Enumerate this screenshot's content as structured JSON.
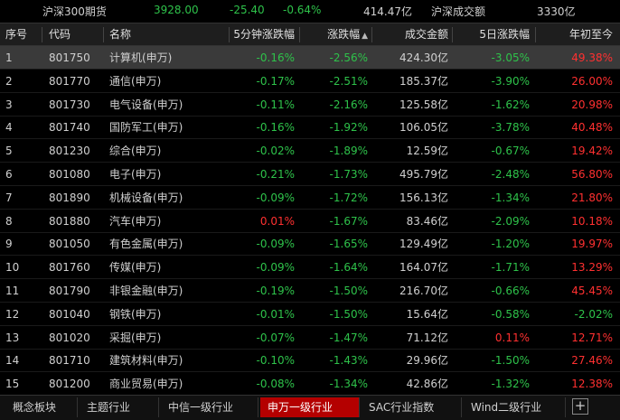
{
  "ticker": {
    "name": "沪深300期货",
    "price": "3928.00",
    "change": "-25.40",
    "change_pct": "-0.64%",
    "amount": "414.47亿",
    "turnover_label": "沪深成交额",
    "turnover_value": "3330亿"
  },
  "columns": {
    "seq": "序号",
    "code": "代码",
    "name": "名称",
    "five_min": "5分钟涨跌幅",
    "change": "涨跌幅",
    "amount": "成交金额",
    "five_day": "5日涨跌幅",
    "ytd": "年初至今",
    "sort_arrow": "▲"
  },
  "rows": [
    {
      "seq": "1",
      "code": "801750",
      "name": "计算机(申万)",
      "five_min": "-0.16%",
      "change": "-2.56%",
      "amount": "424.30亿",
      "five_day": "-3.05%",
      "ytd": "49.38%"
    },
    {
      "seq": "2",
      "code": "801770",
      "name": "通信(申万)",
      "five_min": "-0.17%",
      "change": "-2.51%",
      "amount": "185.37亿",
      "five_day": "-3.90%",
      "ytd": "26.00%"
    },
    {
      "seq": "3",
      "code": "801730",
      "name": "电气设备(申万)",
      "five_min": "-0.11%",
      "change": "-2.16%",
      "amount": "125.58亿",
      "five_day": "-1.62%",
      "ytd": "20.98%"
    },
    {
      "seq": "4",
      "code": "801740",
      "name": "国防军工(申万)",
      "five_min": "-0.16%",
      "change": "-1.92%",
      "amount": "106.05亿",
      "five_day": "-3.78%",
      "ytd": "40.48%"
    },
    {
      "seq": "5",
      "code": "801230",
      "name": "综合(申万)",
      "five_min": "-0.02%",
      "change": "-1.89%",
      "amount": "12.59亿",
      "five_day": "-0.67%",
      "ytd": "19.42%"
    },
    {
      "seq": "6",
      "code": "801080",
      "name": "电子(申万)",
      "five_min": "-0.21%",
      "change": "-1.73%",
      "amount": "495.79亿",
      "five_day": "-2.48%",
      "ytd": "56.80%"
    },
    {
      "seq": "7",
      "code": "801890",
      "name": "机械设备(申万)",
      "five_min": "-0.09%",
      "change": "-1.72%",
      "amount": "156.13亿",
      "five_day": "-1.34%",
      "ytd": "21.80%"
    },
    {
      "seq": "8",
      "code": "801880",
      "name": "汽车(申万)",
      "five_min": "0.01%",
      "change": "-1.67%",
      "amount": "83.46亿",
      "five_day": "-2.09%",
      "ytd": "10.18%"
    },
    {
      "seq": "9",
      "code": "801050",
      "name": "有色金属(申万)",
      "five_min": "-0.09%",
      "change": "-1.65%",
      "amount": "129.49亿",
      "five_day": "-1.20%",
      "ytd": "19.97%"
    },
    {
      "seq": "10",
      "code": "801760",
      "name": "传媒(申万)",
      "five_min": "-0.09%",
      "change": "-1.64%",
      "amount": "164.07亿",
      "five_day": "-1.71%",
      "ytd": "13.29%"
    },
    {
      "seq": "11",
      "code": "801790",
      "name": "非银金融(申万)",
      "five_min": "-0.19%",
      "change": "-1.50%",
      "amount": "216.70亿",
      "five_day": "-0.66%",
      "ytd": "45.45%"
    },
    {
      "seq": "12",
      "code": "801040",
      "name": "钢铁(申万)",
      "five_min": "-0.01%",
      "change": "-1.50%",
      "amount": "15.64亿",
      "five_day": "-0.58%",
      "ytd": "-2.02%"
    },
    {
      "seq": "13",
      "code": "801020",
      "name": "采掘(申万)",
      "five_min": "-0.07%",
      "change": "-1.47%",
      "amount": "71.12亿",
      "five_day": "0.11%",
      "ytd": "12.71%"
    },
    {
      "seq": "14",
      "code": "801710",
      "name": "建筑材料(申万)",
      "five_min": "-0.10%",
      "change": "-1.43%",
      "amount": "29.96亿",
      "five_day": "-1.50%",
      "ytd": "27.46%"
    },
    {
      "seq": "15",
      "code": "801200",
      "name": "商业贸易(申万)",
      "five_min": "-0.08%",
      "change": "-1.34%",
      "amount": "42.86亿",
      "five_day": "-1.32%",
      "ytd": "12.38%"
    }
  ],
  "tabs": [
    {
      "label": "概念板块",
      "active": false
    },
    {
      "label": "主题行业",
      "active": false
    },
    {
      "label": "中信一级行业",
      "active": false
    },
    {
      "label": "申万一级行业",
      "active": true
    },
    {
      "label": "SAC行业指数",
      "active": false
    },
    {
      "label": "Wind二级行业",
      "active": false
    }
  ],
  "add_tab_label": "+",
  "colors": {
    "up": "#ff3030",
    "down": "#2ec24a",
    "active_tab": "#b40000",
    "selected_row": "#3a3a3a"
  }
}
